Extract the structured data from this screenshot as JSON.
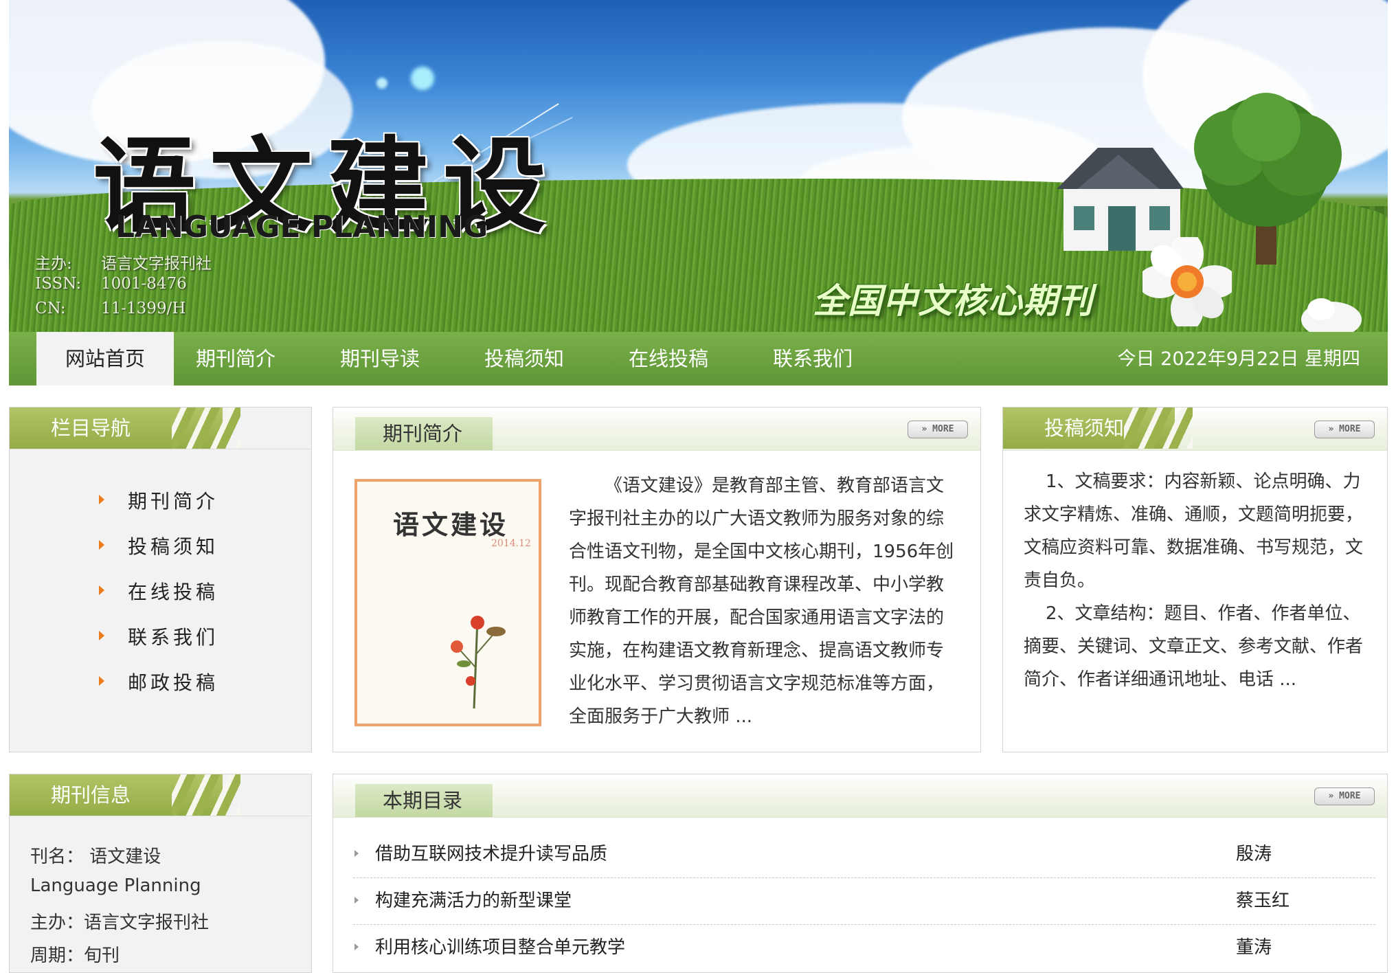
{
  "banner": {
    "title": "语文建设",
    "subtitle_en": "LANGUAGE PLANNING",
    "meta": [
      {
        "key": "主办:",
        "value": "语言文字报刊社"
      },
      {
        "key": "ISSN:",
        "value": "1001-8476"
      },
      {
        "key": "CN:",
        "value": "11-1399/H"
      }
    ],
    "slogan": "全国中文核心期刊"
  },
  "nav": {
    "items": [
      {
        "label": "网站首页",
        "active": true
      },
      {
        "label": "期刊简介"
      },
      {
        "label": "期刊导读"
      },
      {
        "label": "投稿须知"
      },
      {
        "label": "在线投稿"
      },
      {
        "label": "联系我们"
      }
    ],
    "date": "今日 2022年9月22日 星期四"
  },
  "sidebar": {
    "title": "栏目导航",
    "items": [
      "期刊简介",
      "投稿须知",
      "在线投稿",
      "联系我们",
      "邮政投稿"
    ]
  },
  "intro": {
    "title": "期刊简介",
    "more": "» MORE",
    "cover": {
      "title": "语文建设",
      "issue": "2014.12"
    },
    "text": "《语文建设》是教育部主管、教育部语言文字报刊社主办的以广大语文教师为服务对象的综合性语文刊物，是全国中文核心期刊，1956年创刊。现配合教育部基础教育课程改革、中小学教师教育工作的开展，配合国家通用语言文字法的实施，在构建语文教育新理念、提高语文教师专业化水平、学习贯彻语言文字规范标准等方面，全面服务于广大教师 ..."
  },
  "guide": {
    "title": "投稿须知",
    "more": "» MORE",
    "p1": "1、文稿要求：内容新颖、论点明确、力求文字精炼、准确、通顺，文题简明扼要，文稿应资料可靠、数据准确、书写规范，文责自负。",
    "p2": "2、文章结构：题目、作者、作者单位、摘要、关键词、文章正文、参考文献、作者简介、作者详细通讯地址、电话 ..."
  },
  "journal_info": {
    "title": "期刊信息",
    "lines": [
      "刊名： 语文建设",
      " Language Planning",
      "主办：语言文字报刊社",
      "周期：旬刊"
    ]
  },
  "toc": {
    "title": "本期目录",
    "more": "» MORE",
    "rows": [
      {
        "title": "借助互联网技术提升读写品质",
        "author": "殷涛"
      },
      {
        "title": "构建充满活力的新型课堂",
        "author": "蔡玉红"
      },
      {
        "title": "利用核心训练项目整合单元教学",
        "author": "董涛"
      }
    ]
  }
}
